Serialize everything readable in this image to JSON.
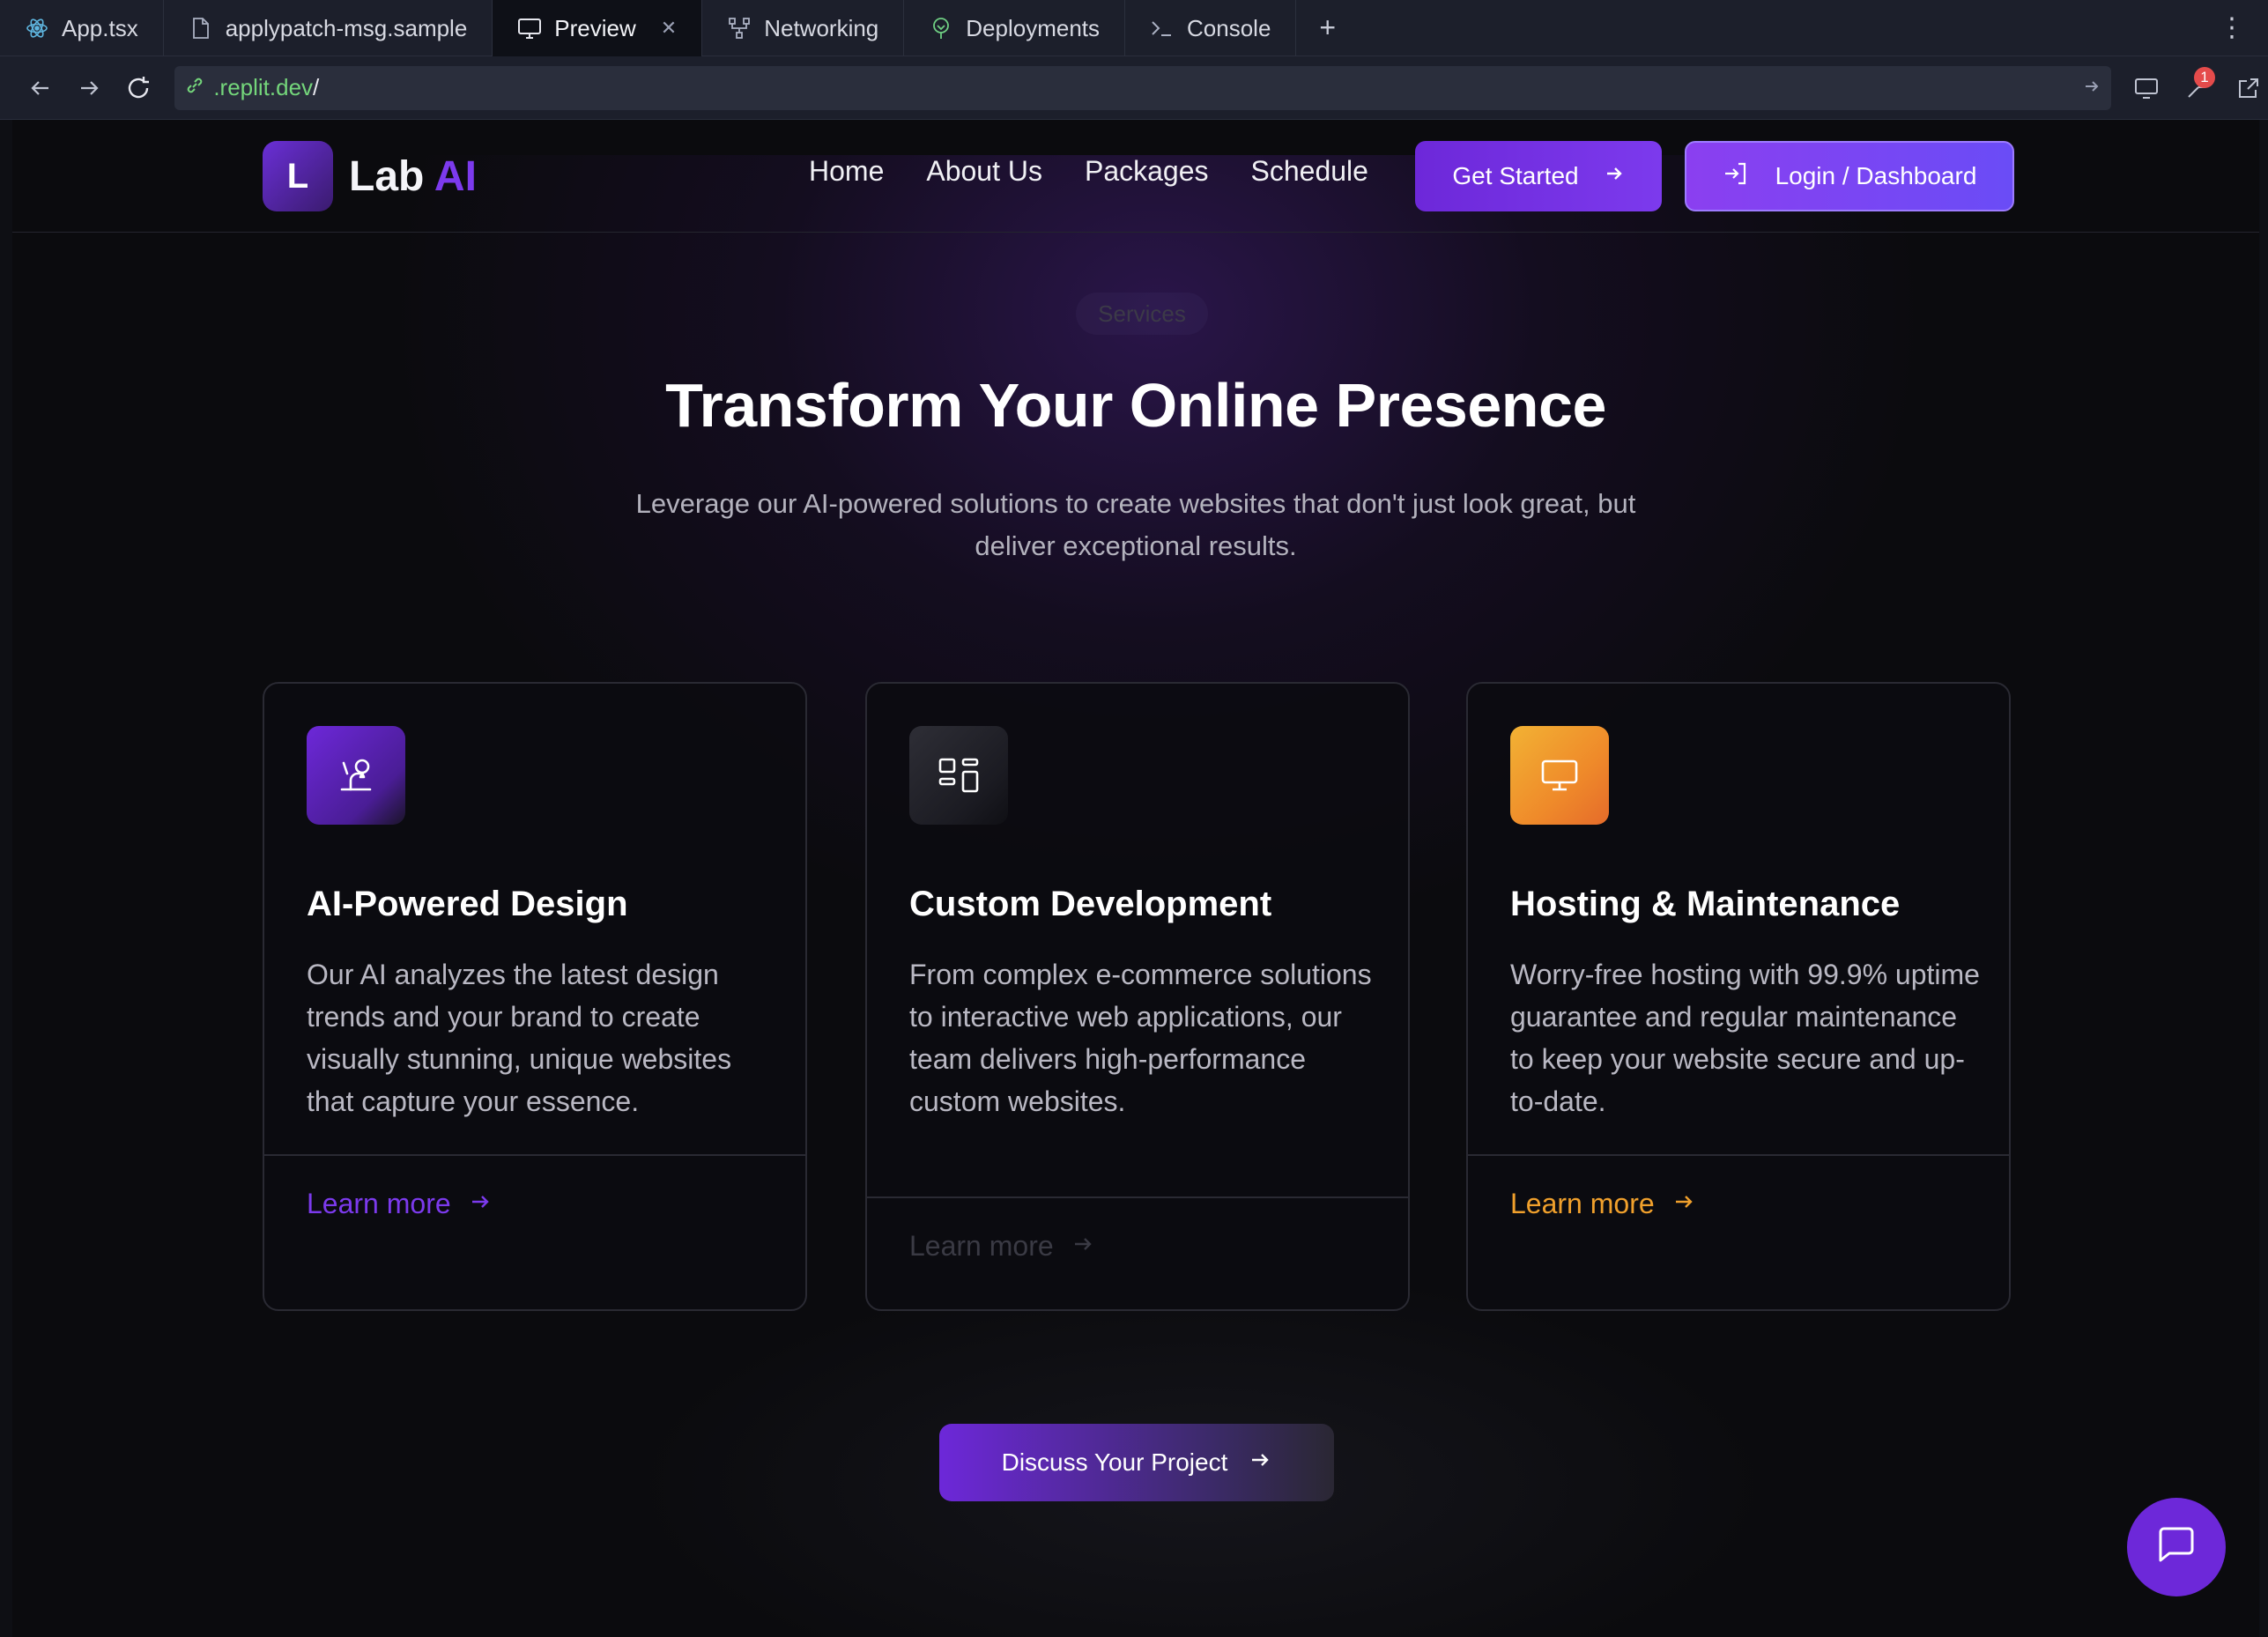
{
  "tabs": [
    {
      "label": "App.tsx",
      "icon": "react-icon"
    },
    {
      "label": "applypatch-msg.sample",
      "icon": "file-icon"
    },
    {
      "label": "Preview",
      "icon": "monitor-icon",
      "active": true
    },
    {
      "label": "Networking",
      "icon": "network-icon"
    },
    {
      "label": "Deployments",
      "icon": "deploy-icon"
    },
    {
      "label": "Console",
      "icon": "terminal-icon"
    }
  ],
  "address": {
    "url_host": ".replit.dev",
    "url_path": "/"
  },
  "notifications": {
    "count": "1"
  },
  "site": {
    "logo_letter": "L",
    "brand": "Lab",
    "brand_accent": "AI",
    "nav": [
      "Home",
      "About Us",
      "Packages",
      "Schedule"
    ],
    "get_started": "Get Started",
    "login": "Login / Dashboard"
  },
  "hero": {
    "pill": "Services",
    "title": "Transform Your Online Presence",
    "subtitle": "Leverage our AI-powered solutions to create websites that don't just look great, but deliver exceptional results."
  },
  "cards": [
    {
      "title": "AI-Powered Design",
      "text": "Our AI analyzes the latest design trends and your brand to create visually stunning, unique websites that capture your essence.",
      "link": "Learn more",
      "icon": "brain-icon",
      "accent": "#7c3aed"
    },
    {
      "title": "Custom Development",
      "text": "From complex e-commerce solutions to interactive web applications, our team delivers high-performance custom websites.",
      "link": "Learn more",
      "icon": "layout-icon",
      "accent": "#3a3a44"
    },
    {
      "title": "Hosting & Maintenance",
      "text": "Worry-free hosting with 99.9% uptime guarantee and regular maintenance to keep your website secure and up-to-date.",
      "link": "Learn more",
      "icon": "monitor-icon",
      "accent": "#f0a02c"
    }
  ],
  "cta": {
    "label": "Discuss Your Project"
  },
  "colors": {
    "brand_purple": "#7c3aed",
    "orange": "#f0a02c",
    "bg": "#0b0b0e"
  }
}
